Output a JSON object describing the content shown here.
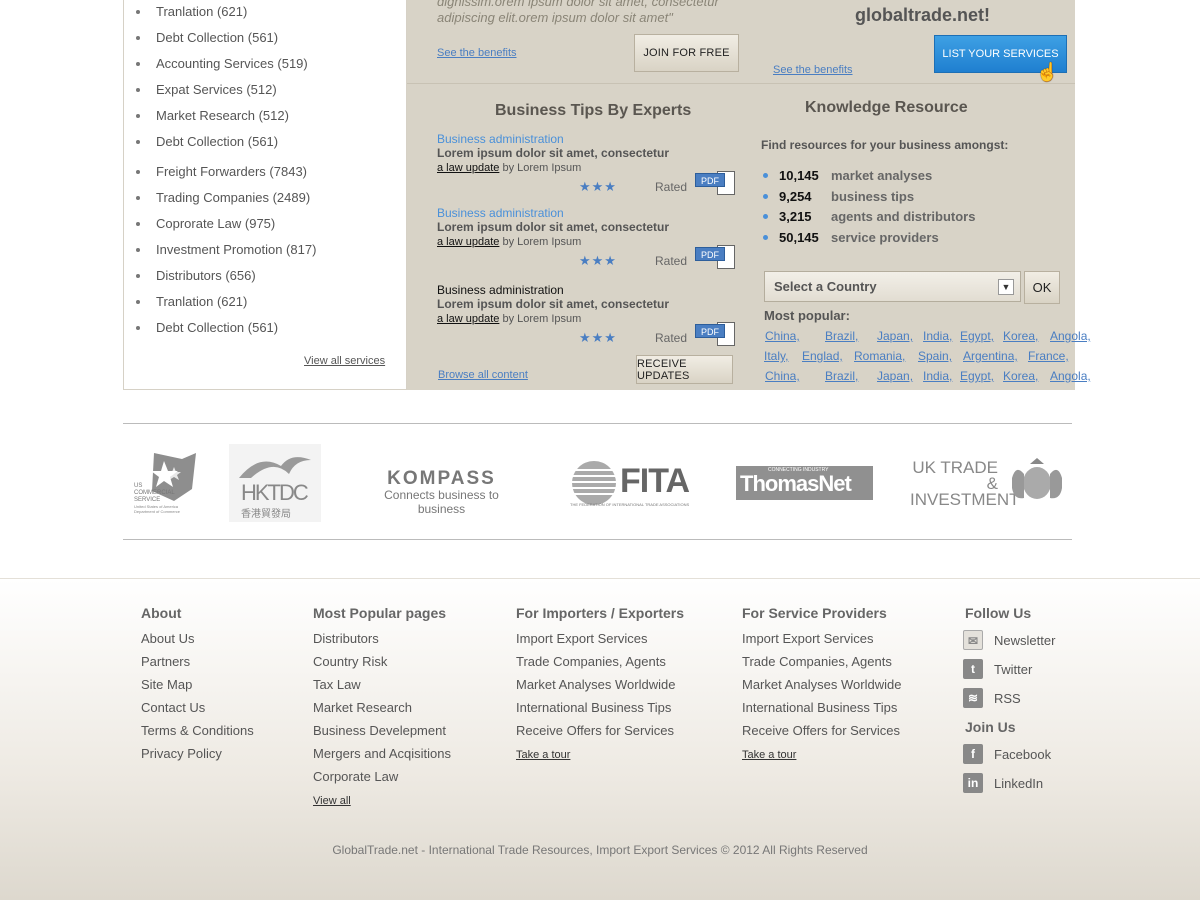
{
  "services": {
    "items": [
      {
        "label": "Tranlation (621)"
      },
      {
        "label": "Debt Collection (561)"
      },
      {
        "label": "Accounting Services (519)"
      },
      {
        "label": "Expat Services (512)"
      },
      {
        "label": "Market Research (512)"
      },
      {
        "label": "Debt Collection (561)"
      },
      {
        "label": "Freight Forwarders (7843)"
      },
      {
        "label": "Trading Companies (2489)"
      },
      {
        "label": "Coprorate Law (975)"
      },
      {
        "label": "Investment Promotion (817)"
      },
      {
        "label": "Distributors (656)"
      },
      {
        "label": "Tranlation (621)"
      },
      {
        "label": "Debt Collection (561)"
      }
    ],
    "view_all": "View all services"
  },
  "promo": {
    "quote": "dignissim.orem ipsum dolor sit amet, consectetur adipiscing elit.orem ipsum dolor sit amet\"",
    "see_benefits_left": "See the benefits",
    "join_label": "JOIN FOR FREE",
    "globaltrade_title": "globaltrade.net!",
    "see_benefits_right": "See the benefits",
    "list_services_label": "LIST YOUR SERVICES"
  },
  "tips": {
    "title": "Business Tips By Experts",
    "items": [
      {
        "category": "Business administration",
        "title": "Lorem ipsum dolor sit amet, consectetur",
        "kind": "a law update",
        "by": "by Lorem Ipsum",
        "rated": "Rated",
        "pdf": "PDF"
      },
      {
        "category": "Business administration",
        "title": "Lorem ipsum dolor sit amet, consectetur",
        "kind": "a law update",
        "by": "by Lorem Ipsum",
        "rated": "Rated",
        "pdf": "PDF"
      },
      {
        "category": "Business administration",
        "title": "Lorem ipsum dolor sit amet, consectetur",
        "kind": "a law update",
        "by": "by Lorem Ipsum",
        "rated": "Rated",
        "pdf": "PDF"
      }
    ],
    "stars": "★★★",
    "browse_all": "Browse all content",
    "receive_updates": "RECEIVE UPDATES"
  },
  "knowledge": {
    "title": "Knowledge Resource",
    "intro": "Find resources for your business amongst:",
    "stats": [
      {
        "num": "10,145",
        "label": "market analyses"
      },
      {
        "num": "9,254",
        "label": "business tips"
      },
      {
        "num": "3,215",
        "label": "agents and distributors"
      },
      {
        "num": "50,145",
        "label": "service providers"
      }
    ],
    "select_placeholder": "Select a Country",
    "ok_label": "OK",
    "most_popular": "Most popular:",
    "countries_row1": [
      "China,",
      "Brazil,",
      "Japan,",
      "India,",
      "Egypt,",
      "Korea,",
      "Angola,"
    ],
    "countries_row2": [
      "Italy,",
      "Englad,",
      "Romania,",
      "Spain,",
      "Argentina,",
      "France,"
    ],
    "countries_row3": [
      "China,",
      "Brazil,",
      "Japan,",
      "India,",
      "Egypt,",
      "Korea,",
      "Angola,"
    ]
  },
  "logos": {
    "us_commercial": "US COMMERCIAL SERVICE",
    "us_commercial_sub": "United States of America Department of Commerce",
    "hktdc": "HKTDC",
    "hktdc_cn": "香港貿發局",
    "kompass": "KOMPASS",
    "kompass_tag": "Connects business to business",
    "fita": "FITA",
    "fita_sub": "THE FEDERATION OF INTERNATIONAL TRADE ASSOCIATIONS",
    "thomasnet": "ThomasNet",
    "thomasnet_sub": "CONNECTING INDUSTRY",
    "uk_trade": "UK TRADE & INVESTMENT"
  },
  "footer": {
    "about": {
      "title": "About",
      "links": [
        "About Us",
        "Partners",
        "Site Map",
        "Contact Us",
        "Terms & Conditions",
        "Privacy Policy"
      ]
    },
    "popular": {
      "title": "Most Popular pages",
      "links": [
        "Distributors",
        "Country Risk",
        "Tax Law",
        "Market Research",
        "Business Develepment",
        "Mergers and Acqisitions",
        "Corporate Law"
      ],
      "view_all": "View all"
    },
    "importers": {
      "title": "For Importers / Exporters",
      "links": [
        "Import Export Services",
        "Trade Companies, Agents",
        "Market Analyses Worldwide",
        "International Business Tips",
        "Receive Offers for Services"
      ],
      "tour": "Take a tour"
    },
    "providers": {
      "title": "For Service Providers",
      "links": [
        "Import Export Services",
        "Trade Companies, Agents",
        "Market Analyses Worldwide",
        "International Business Tips",
        "Receive Offers for Services"
      ],
      "tour": "Take a tour"
    },
    "follow": {
      "title": "Follow Us",
      "items": [
        "Newsletter",
        "Twitter",
        "RSS"
      ]
    },
    "join": {
      "title": "Join Us",
      "items": [
        "Facebook",
        "LinkedIn"
      ]
    },
    "copyright": "GlobalTrade.net - International Trade Resources, Import Export Services © 2012 All Rights Reserved"
  }
}
